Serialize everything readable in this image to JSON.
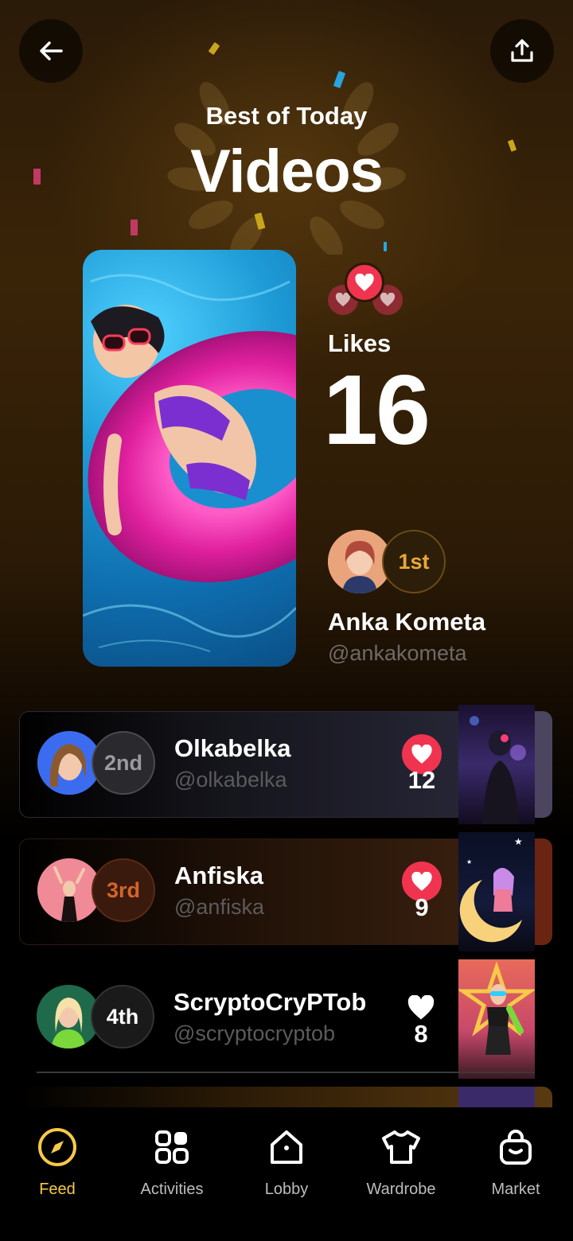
{
  "header": {
    "back_icon": "arrow-left-icon",
    "share_icon": "share-upload-icon",
    "subtitle": "Best of Today",
    "title": "Videos"
  },
  "winner": {
    "likes_label": "Likes",
    "likes_count": "16",
    "rank": "1st",
    "name": "Anka Kometa",
    "handle": "@ankakometa"
  },
  "leaderboard": [
    {
      "rank": "2nd",
      "name": "Olkabelka",
      "handle": "@olkabelka",
      "likes": "12",
      "liked": true
    },
    {
      "rank": "3rd",
      "name": "Anfiska",
      "handle": "@anfiska",
      "likes": "9",
      "liked": true
    },
    {
      "rank": "4th",
      "name": "ScryptoCryPTob",
      "handle": "@scryptocryptob",
      "likes": "8",
      "liked": false
    }
  ],
  "nav": {
    "active": "Feed",
    "items": [
      {
        "label": "Feed",
        "icon": "compass-icon"
      },
      {
        "label": "Activities",
        "icon": "grid-icon"
      },
      {
        "label": "Lobby",
        "icon": "home-icon"
      },
      {
        "label": "Wardrobe",
        "icon": "shirt-icon"
      },
      {
        "label": "Market",
        "icon": "shopping-bag-icon"
      }
    ]
  },
  "colors": {
    "accent": "#f7c948",
    "heart_red": "#f0344f",
    "gold": "#e8a83a",
    "silver": "#9a9aa0",
    "bronze": "#d2652a"
  }
}
